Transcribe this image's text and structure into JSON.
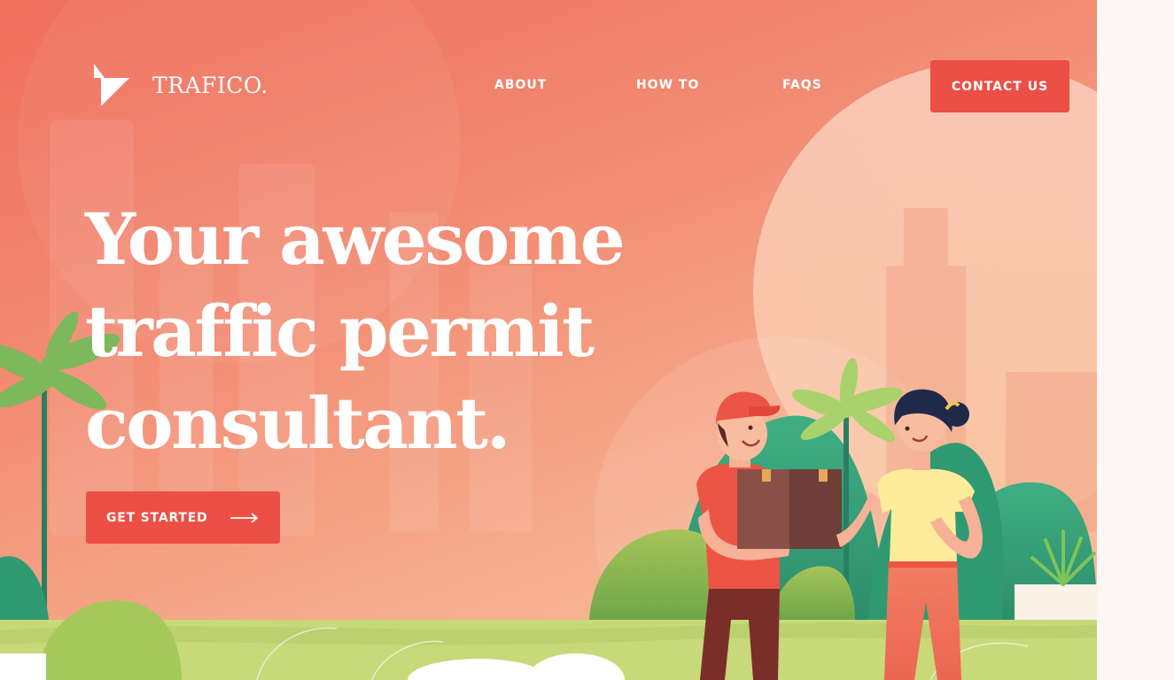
{
  "brand": {
    "name": "TRAFICO.",
    "logo_icon": "triangle-logo-icon"
  },
  "nav": {
    "items": [
      {
        "label": "ABOUT"
      },
      {
        "label": "HOW TO"
      },
      {
        "label": "FAQS"
      }
    ]
  },
  "header": {
    "contact_label": "CONTACT US"
  },
  "hero": {
    "headline_lines": [
      "Your awesome",
      "traffic permit",
      "consultant."
    ],
    "cta_label": "GET STARTED",
    "cta_icon": "arrow-right-icon"
  },
  "colors": {
    "accent": "#ec4f45",
    "gradient_top": "#ef6e5c",
    "gradient_bottom": "#f9c4a2",
    "foliage": "#3fa17c",
    "grass": "#c8d97a"
  }
}
